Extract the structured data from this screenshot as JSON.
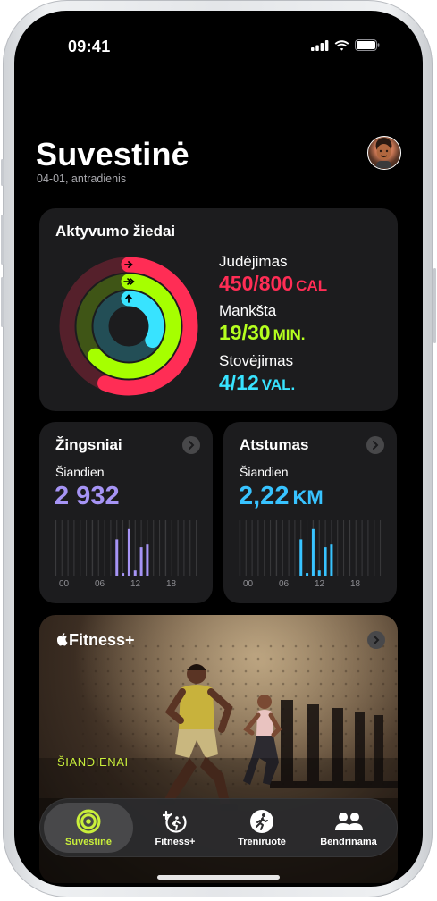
{
  "status_bar": {
    "time": "09:41"
  },
  "header": {
    "title": "Suvestinė",
    "subtitle": "04-01, antradienis"
  },
  "activity": {
    "title": "Aktyvumo žiedai",
    "move": {
      "label": "Judėjimas",
      "value": "450/800",
      "unit": "CAL",
      "fraction": 0.5625,
      "color": "#ff2d55"
    },
    "exercise": {
      "label": "Mankšta",
      "value": "19/30",
      "unit": "MIN.",
      "fraction": 0.6333,
      "color": "#a6ff00"
    },
    "stand": {
      "label": "Stovėjimas",
      "value": "4/12",
      "unit": "VAL.",
      "fraction": 0.3333,
      "color": "#38e3ff"
    }
  },
  "steps": {
    "title": "Žingsniai",
    "period": "Šiandien",
    "value": "2 932",
    "color": "#a694f5",
    "axis": [
      "00",
      "06",
      "12",
      "18"
    ],
    "hourly_fraction": [
      0,
      0,
      0,
      0,
      0,
      0,
      0,
      0,
      0,
      0,
      0.7,
      0.05,
      0.9,
      0.1,
      0.55,
      0.6,
      0,
      0,
      0,
      0,
      0,
      0,
      0,
      0
    ]
  },
  "distance": {
    "title": "Atstumas",
    "period": "Šiandien",
    "value": "2,22",
    "unit": "KM",
    "color": "#38c3ff",
    "axis": [
      "00",
      "06",
      "12",
      "18"
    ],
    "hourly_fraction": [
      0,
      0,
      0,
      0,
      0,
      0,
      0,
      0,
      0,
      0,
      0.7,
      0.05,
      0.9,
      0.1,
      0.55,
      0.6,
      0,
      0,
      0,
      0,
      0,
      0,
      0,
      0
    ]
  },
  "fitness_plus": {
    "logo": "Fitness+",
    "label": "ŠIANDIENAI"
  },
  "tabbar": {
    "items": [
      {
        "label": "Suvestinė",
        "icon": "summary-rings-icon",
        "active": true,
        "color": "#c9ef3b"
      },
      {
        "label": "Fitness+",
        "icon": "fitness-plus-icon",
        "active": false,
        "color": "#ffffff"
      },
      {
        "label": "Treniruotė",
        "icon": "workout-runner-icon",
        "active": false,
        "color": "#ffffff"
      },
      {
        "label": "Bendrinama",
        "icon": "sharing-people-icon",
        "active": false,
        "color": "#ffffff"
      }
    ]
  }
}
